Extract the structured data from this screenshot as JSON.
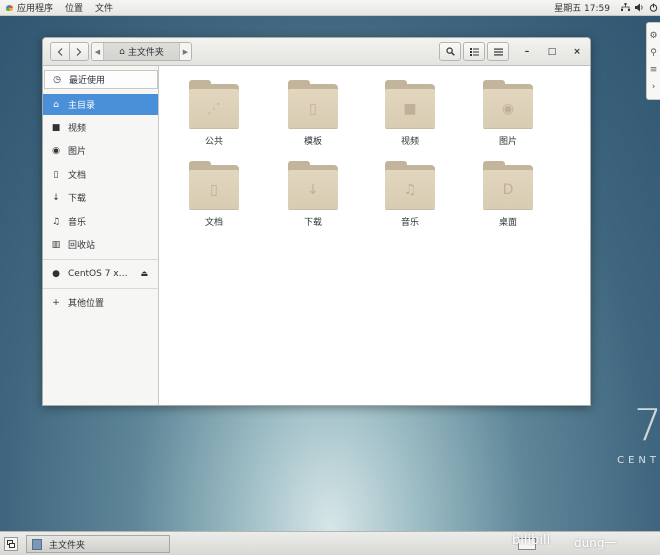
{
  "topbar": {
    "apps_label": "应用程序",
    "places_label": "位置",
    "file_label": "文件",
    "clock": "星期五 17:59",
    "network_icon": "network-icon",
    "volume_icon": "volume-icon"
  },
  "window": {
    "path_crumb": "主文件夹",
    "controls": {
      "minimize": "–",
      "maximize": "□",
      "close": "×"
    }
  },
  "sidebar": {
    "recent": "最近使用",
    "items": [
      {
        "label": "主目录",
        "icon": "home-icon",
        "glyph": "⌂"
      },
      {
        "label": "视频",
        "icon": "video-icon",
        "glyph": "■"
      },
      {
        "label": "图片",
        "icon": "camera-icon",
        "glyph": "◉"
      },
      {
        "label": "文档",
        "icon": "document-icon",
        "glyph": "▯"
      },
      {
        "label": "下载",
        "icon": "download-icon",
        "glyph": "↓"
      },
      {
        "label": "音乐",
        "icon": "music-icon",
        "glyph": "♫"
      },
      {
        "label": "回收站",
        "icon": "trash-icon",
        "glyph": "▥"
      }
    ],
    "device": "CentOS 7 x…",
    "other": "其他位置"
  },
  "folders": [
    {
      "label": "公共",
      "icon": "share-icon",
      "glyph": "⋰"
    },
    {
      "label": "模板",
      "icon": "template-icon",
      "glyph": "▯"
    },
    {
      "label": "视频",
      "icon": "video-icon",
      "glyph": "■"
    },
    {
      "label": "图片",
      "icon": "camera-icon",
      "glyph": "◉"
    },
    {
      "label": "文档",
      "icon": "documents-icon",
      "glyph": "▯"
    },
    {
      "label": "下载",
      "icon": "download-icon",
      "glyph": "↓"
    },
    {
      "label": "音乐",
      "icon": "music-icon",
      "glyph": "♫"
    },
    {
      "label": "桌面",
      "icon": "desktop-icon",
      "glyph": "D"
    }
  ],
  "taskbar": {
    "window_item": "主文件夹",
    "brand_mark": "bilibili",
    "brand_text": "dung一"
  },
  "desktop": {
    "cent_text": "CENT"
  }
}
